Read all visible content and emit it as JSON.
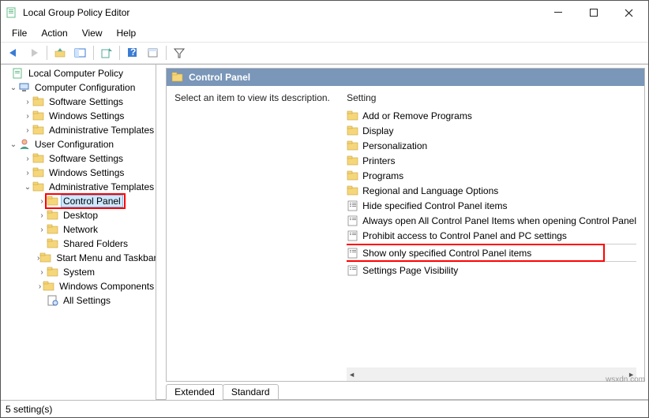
{
  "window": {
    "title": "Local Group Policy Editor"
  },
  "menu": {
    "file": "File",
    "action": "Action",
    "view": "View",
    "help": "Help"
  },
  "tree": {
    "root": "Local Computer Policy",
    "computer_config": "Computer Configuration",
    "cc_software": "Software Settings",
    "cc_windows": "Windows Settings",
    "cc_admin": "Administrative Templates",
    "user_config": "User Configuration",
    "uc_software": "Software Settings",
    "uc_windows": "Windows Settings",
    "uc_admin": "Administrative Templates",
    "uc_control_panel": "Control Panel",
    "uc_desktop": "Desktop",
    "uc_network": "Network",
    "uc_shared": "Shared Folders",
    "uc_startmenu": "Start Menu and Taskbar",
    "uc_system": "System",
    "uc_wincomp": "Windows Components",
    "uc_allsettings": "All Settings"
  },
  "right": {
    "header": "Control Panel",
    "description_prompt": "Select an item to view its description.",
    "column_setting": "Setting"
  },
  "settings_list": {
    "item0": "Add or Remove Programs",
    "item1": "Display",
    "item2": "Personalization",
    "item3": "Printers",
    "item4": "Programs",
    "item5": "Regional and Language Options",
    "item6": "Hide specified Control Panel items",
    "item7": "Always open All Control Panel Items when opening Control Panel",
    "item8": "Prohibit access to Control Panel and PC settings",
    "item9": "Show only specified Control Panel items",
    "item10": "Settings Page Visibility"
  },
  "tabs": {
    "extended": "Extended",
    "standard": "Standard"
  },
  "status": {
    "text": "5 setting(s)"
  },
  "watermark": "wsxdn.com"
}
